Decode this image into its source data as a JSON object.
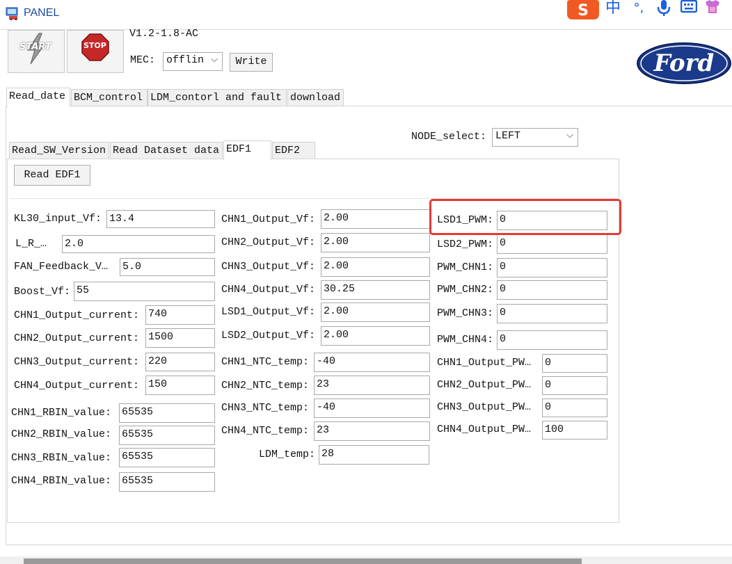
{
  "window": {
    "title": "PANEL"
  },
  "toolbar": {
    "start_label": "START",
    "stop_label": "STOP",
    "version": "V1.2-1.8-AC",
    "mec_label": "MEC:",
    "mec_value": "offlin",
    "write_label": "Write",
    "brand": "Ford"
  },
  "ime": {
    "lang": "中",
    "punct": "°,"
  },
  "main_tabs": [
    "Read_date",
    "BCM_control",
    "LDM_contorl and fault",
    "download"
  ],
  "node_select": {
    "label": "NODE_select:",
    "value": "LEFT"
  },
  "sub_tabs": [
    "Read_SW_Version",
    "Read Dataset data",
    "EDF1",
    "EDF2"
  ],
  "read_button": "Read EDF1",
  "col1": [
    {
      "label": "KL30_input_Vf:",
      "value": "13.4"
    },
    {
      "label": "L_R_…",
      "value": "2.0"
    },
    {
      "label": "FAN_Feedback_V…",
      "value": "5.0"
    },
    {
      "label": "Boost_Vf:",
      "value": "55"
    },
    {
      "label": "CHN1_Output_current:",
      "value": "740"
    },
    {
      "label": "CHN2_Output_current:",
      "value": "1500"
    },
    {
      "label": "CHN3_Output_current:",
      "value": "220"
    },
    {
      "label": "CHN4_Output_current:",
      "value": "150"
    },
    {
      "label": "CHN1_RBIN_value:",
      "value": "65535"
    },
    {
      "label": "CHN2_RBIN_value:",
      "value": "65535"
    },
    {
      "label": "CHN3_RBIN_value:",
      "value": "65535"
    },
    {
      "label": "CHN4_RBIN_value:",
      "value": "65535"
    }
  ],
  "col2": [
    {
      "label": "CHN1_Output_Vf:",
      "value": "2.00"
    },
    {
      "label": "CHN2_Output_Vf:",
      "value": "2.00"
    },
    {
      "label": "CHN3_Output_Vf:",
      "value": "2.00"
    },
    {
      "label": "CHN4_Output_Vf:",
      "value": "30.25"
    },
    {
      "label": "LSD1_Output_Vf:",
      "value": "2.00"
    },
    {
      "label": "LSD2_Output_Vf:",
      "value": "2.00"
    },
    {
      "label": "CHN1_NTC_temp:",
      "value": "-40"
    },
    {
      "label": "CHN2_NTC_temp:",
      "value": "23"
    },
    {
      "label": "CHN3_NTC_temp:",
      "value": "-40"
    },
    {
      "label": "CHN4_NTC_temp:",
      "value": "23"
    },
    {
      "label": "LDM_temp:",
      "value": "28"
    }
  ],
  "col3": [
    {
      "label": "LSD1_PWM:",
      "value": "0"
    },
    {
      "label": "LSD2_PWM:",
      "value": "0"
    },
    {
      "label": "PWM_CHN1:",
      "value": "0"
    },
    {
      "label": "PWM_CHN2:",
      "value": "0"
    },
    {
      "label": "PWM_CHN3:",
      "value": "0"
    },
    {
      "label": "PWM_CHN4:",
      "value": "0"
    },
    {
      "label": "CHN1_Output_PW…",
      "value": "0"
    },
    {
      "label": "CHN2_Output_PW…",
      "value": "0"
    },
    {
      "label": "CHN3_Output_PW…",
      "value": "0"
    },
    {
      "label": "CHN4_Output_PW…",
      "value": "100"
    }
  ],
  "colors": {
    "highlight": "#e53935",
    "ford_blue": "#1b3a8c",
    "stop_red": "#c62828"
  }
}
